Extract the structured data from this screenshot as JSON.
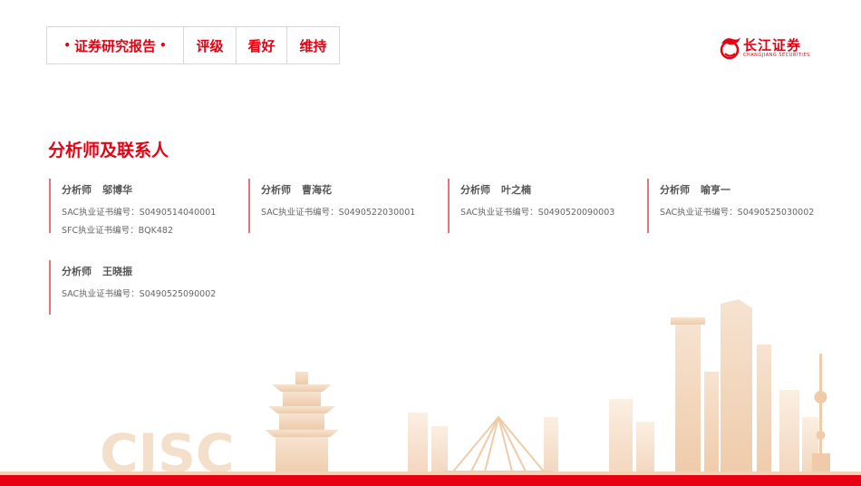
{
  "header": {
    "report_type": "证券研究报告",
    "rating_label": "评级",
    "rating_value": "看好",
    "rating_action": "维持"
  },
  "brand": {
    "name": "长江证券",
    "english": "CHANGJIANG SECURITIES",
    "watermark": "CJSC",
    "accent_color": "#e60012"
  },
  "section": {
    "title": "分析师及联系人"
  },
  "analysts": [
    {
      "role": "分析师",
      "name": "邬博华",
      "lines": [
        "SAC执业证书编号：S0490514040001",
        "SFC执业证书编号：BQK482"
      ]
    },
    {
      "role": "分析师",
      "name": "曹海花",
      "lines": [
        "SAC执业证书编号：S0490522030001"
      ]
    },
    {
      "role": "分析师",
      "name": "叶之楠",
      "lines": [
        "SAC执业证书编号：S0490520090003"
      ]
    },
    {
      "role": "分析师",
      "name": "喻亨一",
      "lines": [
        "SAC执业证书编号：S0490525030002"
      ]
    },
    {
      "role": "分析师",
      "name": "王晓振",
      "lines": [
        "SAC执业证书编号：S0490525090002"
      ]
    }
  ]
}
